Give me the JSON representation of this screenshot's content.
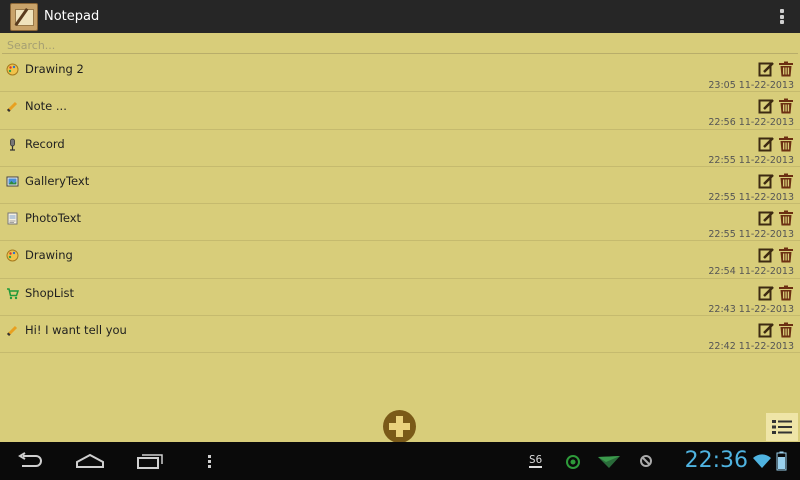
{
  "app": {
    "title": "Notepad"
  },
  "search": {
    "placeholder": "Search..."
  },
  "notes": [
    {
      "label": "Drawing 2",
      "type_icon": "palette-icon",
      "date": "23:05 11-22-2013"
    },
    {
      "label": "Note ...",
      "type_icon": "pencil-icon",
      "date": "22:56 11-22-2013"
    },
    {
      "label": "Record",
      "type_icon": "microphone-icon",
      "date": "22:55 11-22-2013"
    },
    {
      "label": "GalleryText",
      "type_icon": "gallery-icon",
      "date": "22:55 11-22-2013"
    },
    {
      "label": "PhotoText",
      "type_icon": "photo-icon",
      "date": "22:55 11-22-2013"
    },
    {
      "label": "Drawing",
      "type_icon": "palette-icon",
      "date": "22:54 11-22-2013"
    },
    {
      "label": "ShopList",
      "type_icon": "cart-icon",
      "date": "22:43 11-22-2013"
    },
    {
      "label": "Hi! I want tell you",
      "type_icon": "pencil-icon",
      "date": "22:42 11-22-2013"
    }
  ],
  "status": {
    "time": "22:36",
    "notification": "S6"
  },
  "colors": {
    "background": "#d8cd7a",
    "actionbar": "#262626",
    "accent": "#7a5a18",
    "clock": "#4fb3e0"
  }
}
